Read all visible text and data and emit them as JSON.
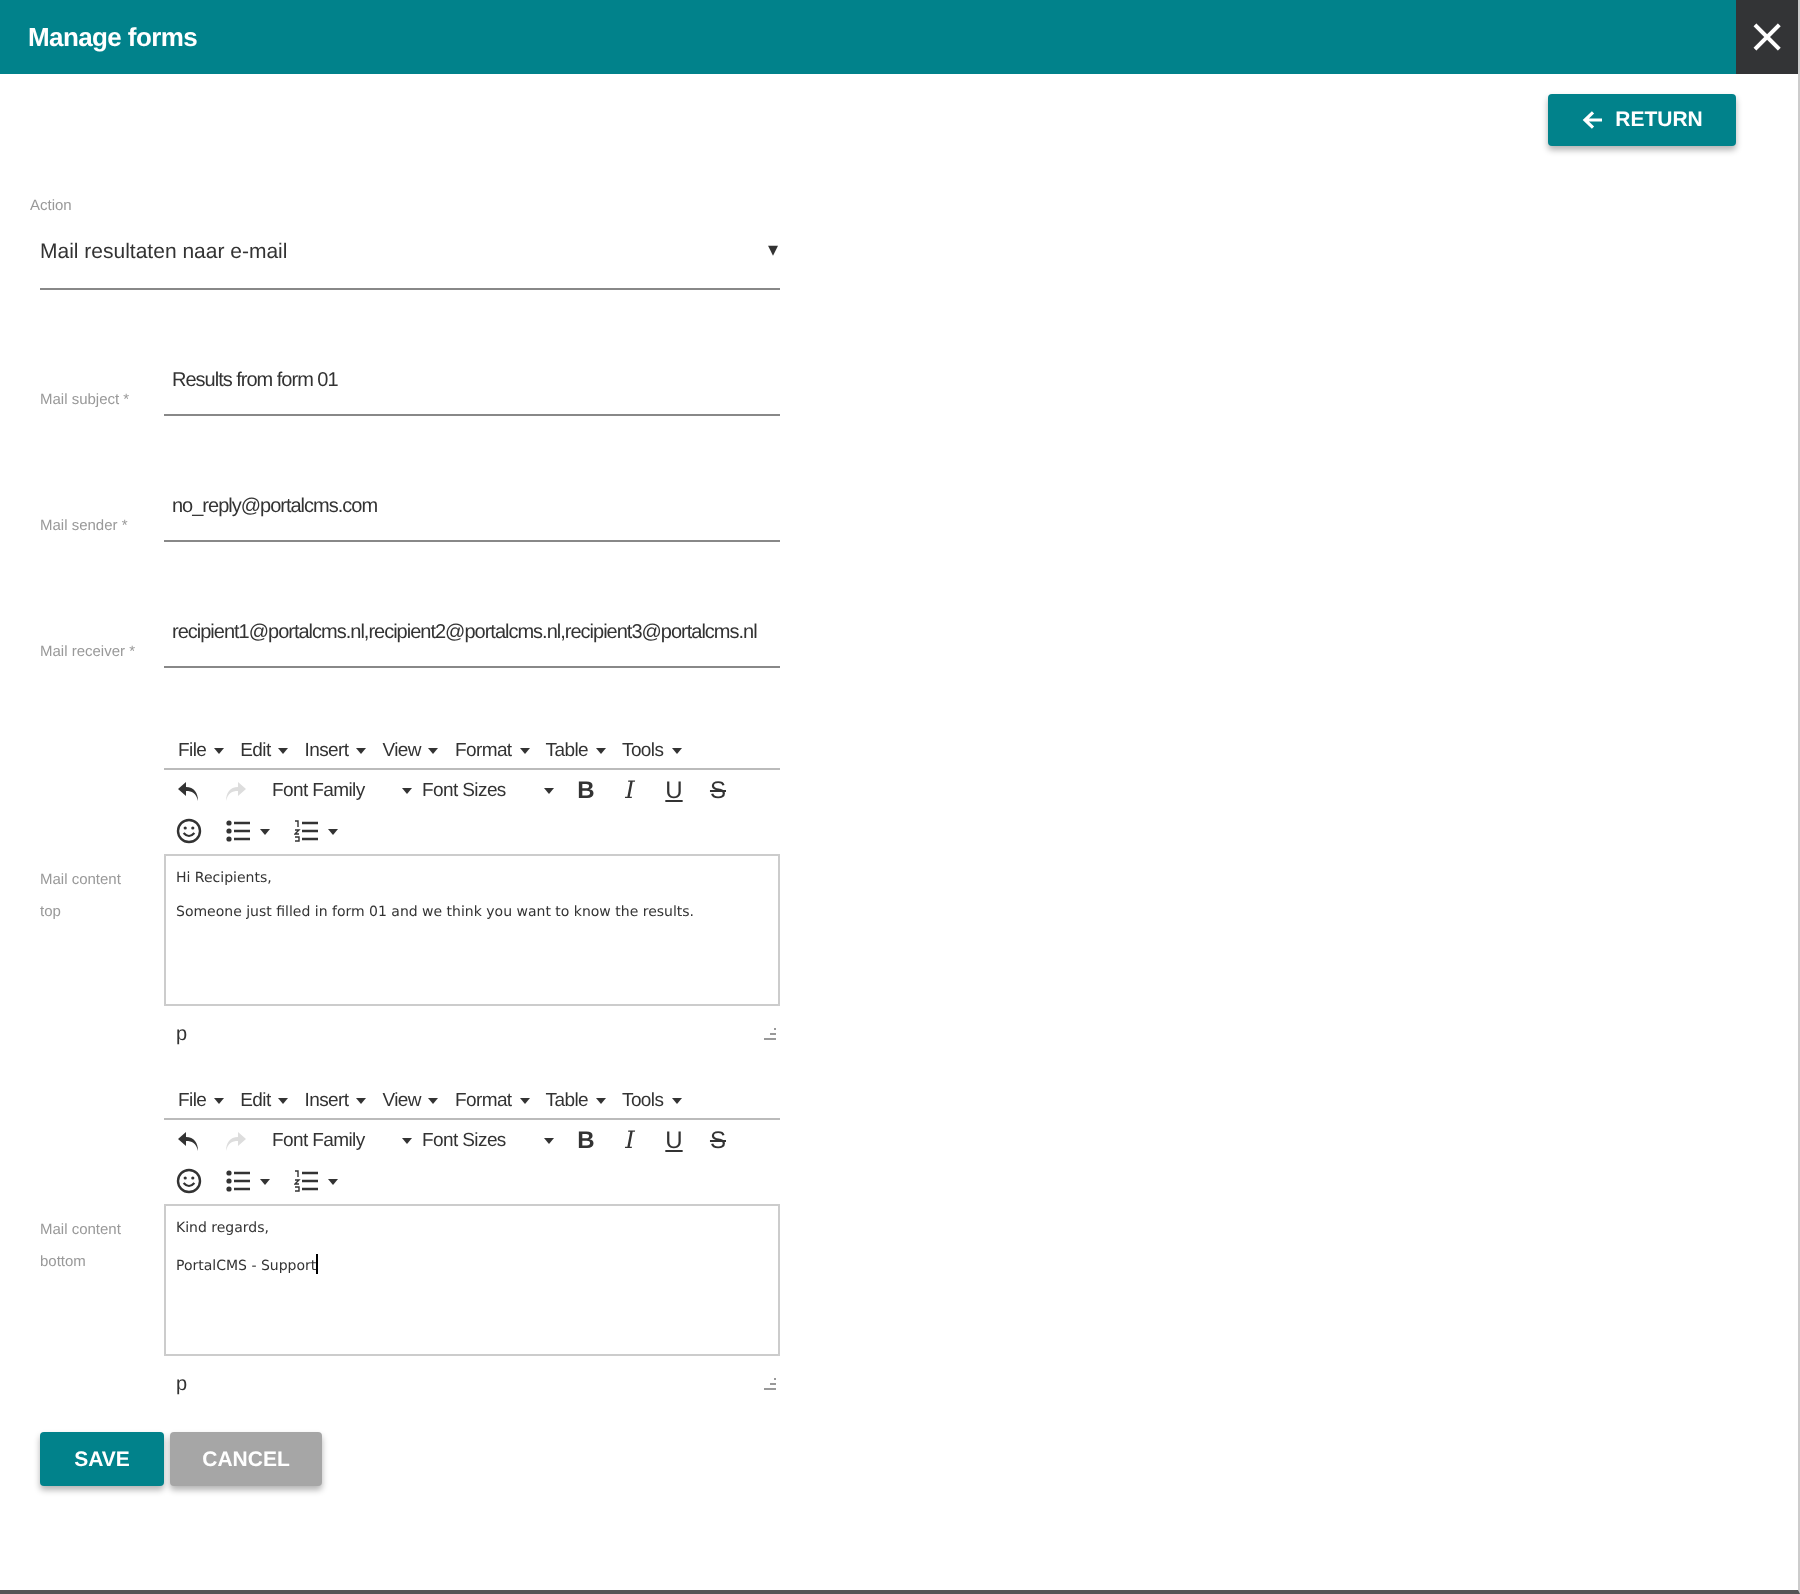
{
  "window": {
    "title": "Manage forms",
    "close": "×"
  },
  "return_button": "RETURN",
  "action": {
    "label": "Action",
    "value": "Mail resultaten naar e-mail",
    "arrow": "▾"
  },
  "fields": [
    {
      "label": "Mail subject *",
      "value": "Results from form 01"
    },
    {
      "label": "Mail sender *",
      "value": "no_reply@portalcms.com"
    },
    {
      "label": "Mail receiver *",
      "value": "recipient1@portalcms.nl,recipient2@portalcms.nl,recipient3@portalcms.nl"
    }
  ],
  "editors": [
    {
      "label": "Mail content top",
      "menu": [
        "File",
        "Edit",
        "Insert",
        "View",
        "Format",
        "Table",
        "Tools"
      ],
      "font_family": "Font Family",
      "font_sizes": "Font Sizes",
      "format_buttons": [
        "B",
        "I",
        "U",
        "S"
      ],
      "content": [
        "Hi Recipients,",
        "Someone just filled in form 01 and we think you want to know the results."
      ],
      "status_path": "p",
      "focused": false
    },
    {
      "label": "Mail content bottom",
      "menu": [
        "File",
        "Edit",
        "Insert",
        "View",
        "Format",
        "Table",
        "Tools"
      ],
      "font_family": "Font Family",
      "font_sizes": "Font Sizes",
      "format_buttons": [
        "B",
        "I",
        "U",
        "S"
      ],
      "content": [
        "Kind regards,",
        "PortalCMS - Support"
      ],
      "status_path": "p",
      "focused": true
    }
  ],
  "buttons": [
    {
      "label": "SAVE",
      "kind": "primary"
    },
    {
      "label": "CANCEL",
      "kind": "secondary"
    }
  ]
}
